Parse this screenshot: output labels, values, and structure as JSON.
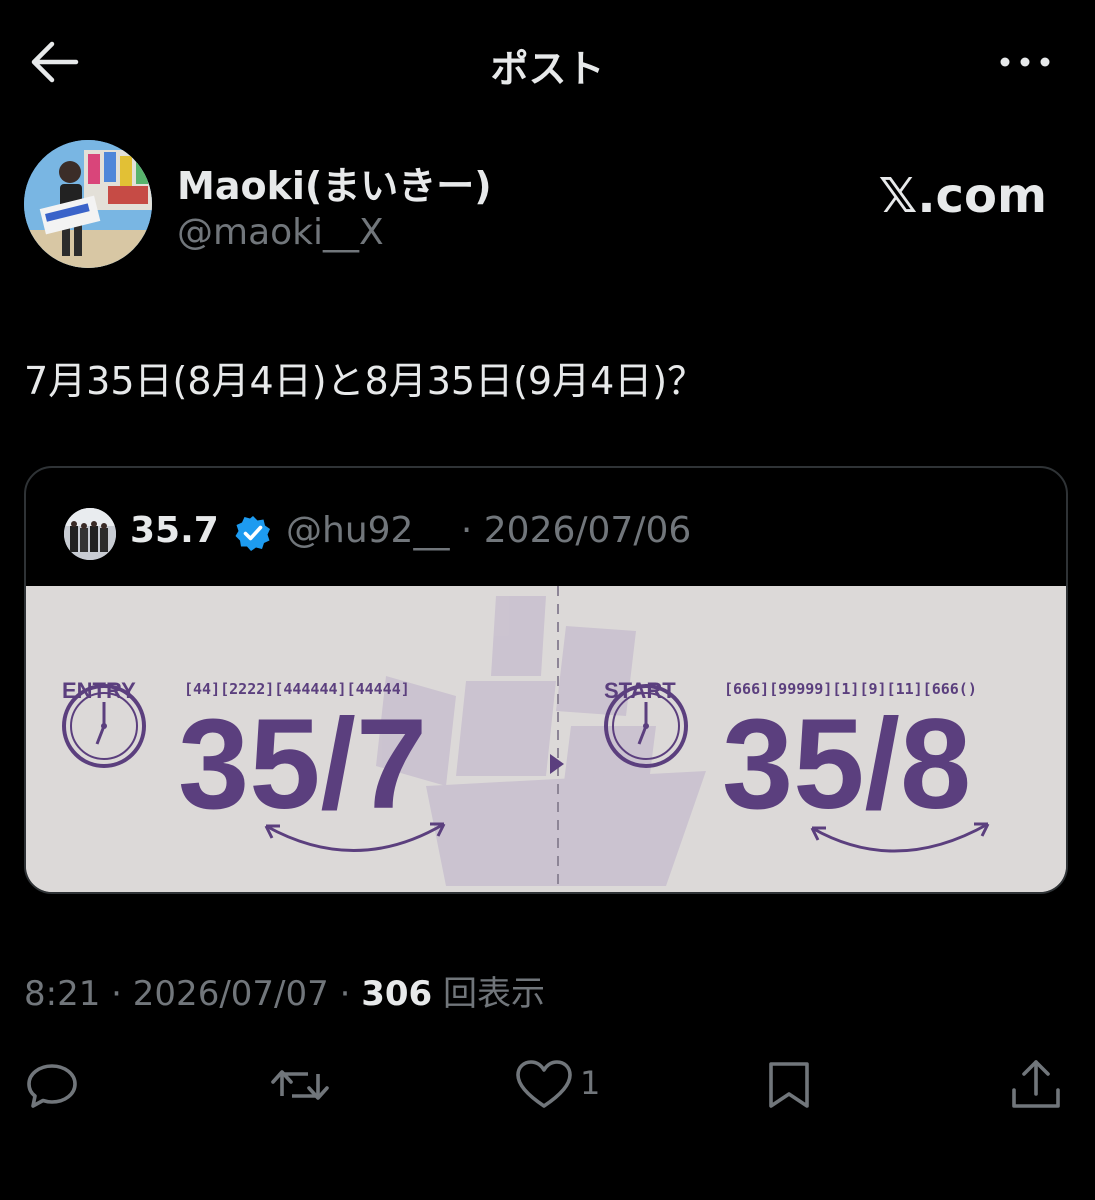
{
  "header": {
    "title": "ポスト"
  },
  "author": {
    "name": "Maoki(まいきー)",
    "handle": "@maoki__X"
  },
  "watermark": "𝕏.com",
  "post": {
    "text": "7月35日(8月4日)と8月35日(9月4日)？"
  },
  "quote": {
    "name": "35.7",
    "handle_date": "@hu92__ · 2026/07/06",
    "image": {
      "left_label": "ENTRY",
      "left_code": "[44][2222][444444][44444]",
      "left_number": "35/7",
      "right_label": "START",
      "right_code": "[666][99999][1][9][11][666()",
      "right_number": "35/8"
    }
  },
  "meta": {
    "time": "8:21",
    "date": "2026/07/07",
    "views_count": "306",
    "views_label": "回表示"
  },
  "actions": {
    "like_count": "1"
  },
  "colors": {
    "accent_purple": "#5b3f7e",
    "verified_blue": "#1d9bf0",
    "muted": "#71767b"
  }
}
